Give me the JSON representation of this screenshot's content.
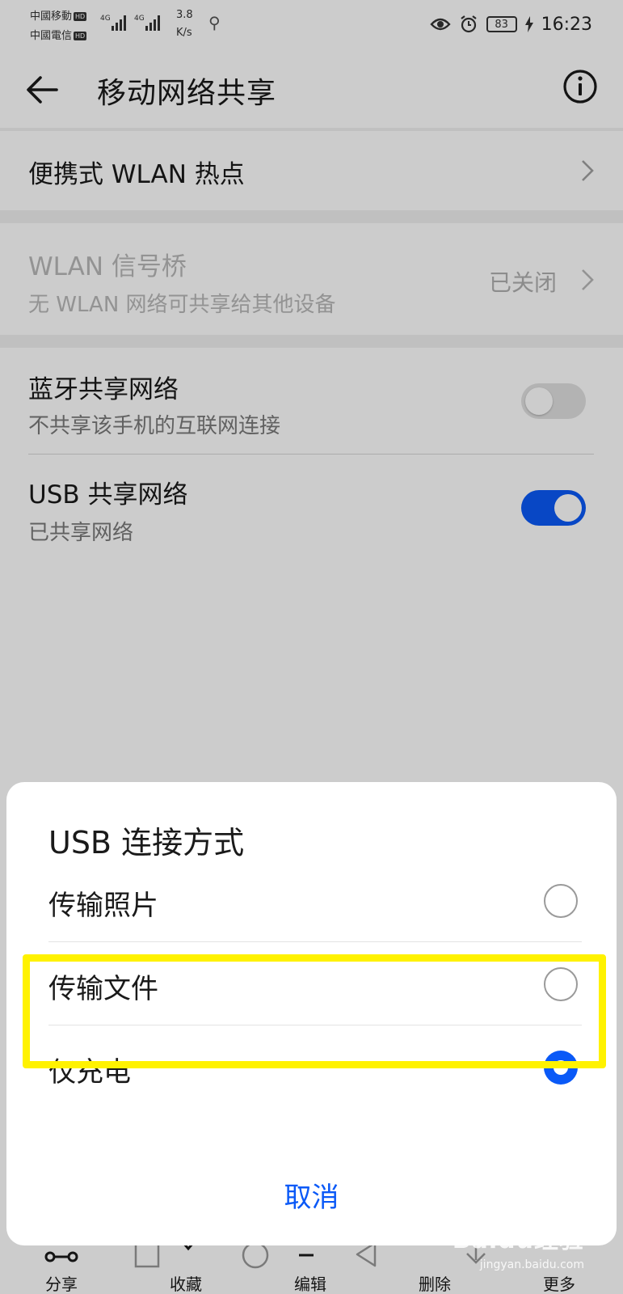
{
  "status_bar": {
    "carrier1": "中國移動",
    "carrier2": "中國電信",
    "hd": "HD",
    "network1": "4G",
    "network2": "4G",
    "speed_value": "3.8",
    "speed_unit": "K/s",
    "battery": "83",
    "time": "16:23"
  },
  "app_bar": {
    "title": "移动网络共享"
  },
  "rows": {
    "wlan_hotspot": {
      "title": "便携式 WLAN 热点"
    },
    "wlan_bridge": {
      "title": "WLAN 信号桥",
      "subtitle": "无 WLAN 网络可共享给其他设备",
      "status": "已关闭"
    },
    "bluetooth": {
      "title": "蓝牙共享网络",
      "subtitle": "不共享该手机的互联网连接",
      "enabled": false
    },
    "usb": {
      "title": "USB 共享网络",
      "subtitle": "已共享网络",
      "enabled": true
    }
  },
  "toolbar": {
    "share": "分享",
    "favorite": "收藏",
    "edit": "编辑",
    "delete": "删除",
    "more": "更多"
  },
  "dialog": {
    "title": "USB 连接方式",
    "options": [
      {
        "label": "传输照片",
        "selected": false
      },
      {
        "label": "传输文件",
        "selected": false
      },
      {
        "label": "仅充电",
        "selected": true
      }
    ],
    "cancel": "取消"
  },
  "watermark": {
    "brand": "Baidu经验",
    "site": "jingyan.baidu.com"
  },
  "colors": {
    "accent": "#0a59f7",
    "highlight": "#fff200"
  }
}
